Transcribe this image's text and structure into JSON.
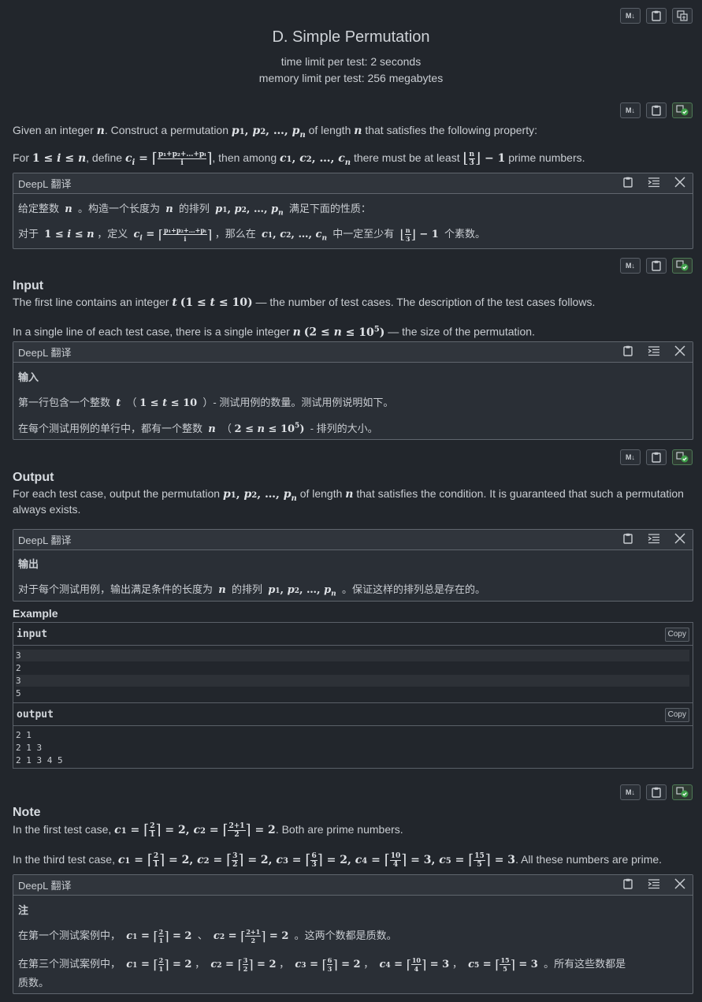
{
  "header": {
    "title": "D. Simple Permutation",
    "time_limit": "time limit per test: 2 seconds",
    "memory_limit": "memory limit per test: 256 megabytes",
    "buttons": [
      "M↓"
    ]
  },
  "statement": {
    "line1_a": "Given an integer",
    "line1_b": ". Construct a permutation",
    "line1_c": "of length",
    "line1_d": "that satisfies the following property:",
    "line2_a": "For",
    "line2_b": ", define",
    "line2_c": ", then among",
    "line2_d": "there must be at least",
    "line2_e": "prime numbers.",
    "deepl_label": "DeepL 翻译",
    "zh1_a": "给定整数",
    "zh1_b": "。构造一个长度为",
    "zh1_c": "的排列",
    "zh1_d": "满足下面的性质：",
    "zh2_a": "对于",
    "zh2_b": "，定义",
    "zh2_c": "，那么在",
    "zh2_d": "中一定至少有",
    "zh2_e": "个素数。"
  },
  "input": {
    "heading": "Input",
    "line1_a": "The first line contains an integer",
    "line1_b": "— the number of test cases. The description of the test cases follows.",
    "line2_a": "In a single line of each test case, there is a single integer",
    "line2_b": "— the size of the permutation.",
    "zh_heading": "输入",
    "zh1_a": "第一行包含一个整数",
    "zh1_b": "- 测试用例的数量。测试用例说明如下。",
    "zh2_a": "在每个测试用例的单行中，都有一个整数",
    "zh2_b": "- 排列的大小。"
  },
  "output": {
    "heading": "Output",
    "line1_a": "For each test case, output the permutation",
    "line1_b": "of length",
    "line1_c": "that satisfies the condition. It is guaranteed that such a permutation",
    "line1_d": "always exists.",
    "zh_heading": "输出",
    "zh1_a": "对于每个测试用例，输出满足条件的长度为",
    "zh1_b": "的排列",
    "zh1_c": "。保证这样的排列总是存在的。"
  },
  "example": {
    "heading": "Example",
    "input_label": "input",
    "output_label": "output",
    "copy_label": "Copy",
    "input_lines": [
      "3",
      "2",
      "3",
      "5"
    ],
    "output_lines": [
      "2 1",
      "2 1 3",
      "2 1 3 4 5"
    ]
  },
  "note": {
    "heading": "Note",
    "line1_a": "In the first test case,",
    "line1_b": ". Both are prime numbers.",
    "line2_a": "In the third test case,",
    "line2_b": ". All these numbers are prime.",
    "zh_heading": "注",
    "zh1_a": "在第一个测试案例中，",
    "zh1_b": "。这两个数都是质数。",
    "zh2_a": "在第三个测试案例中，",
    "zh2_b": "。所有这些数都是",
    "zh2_c": "质数。"
  }
}
